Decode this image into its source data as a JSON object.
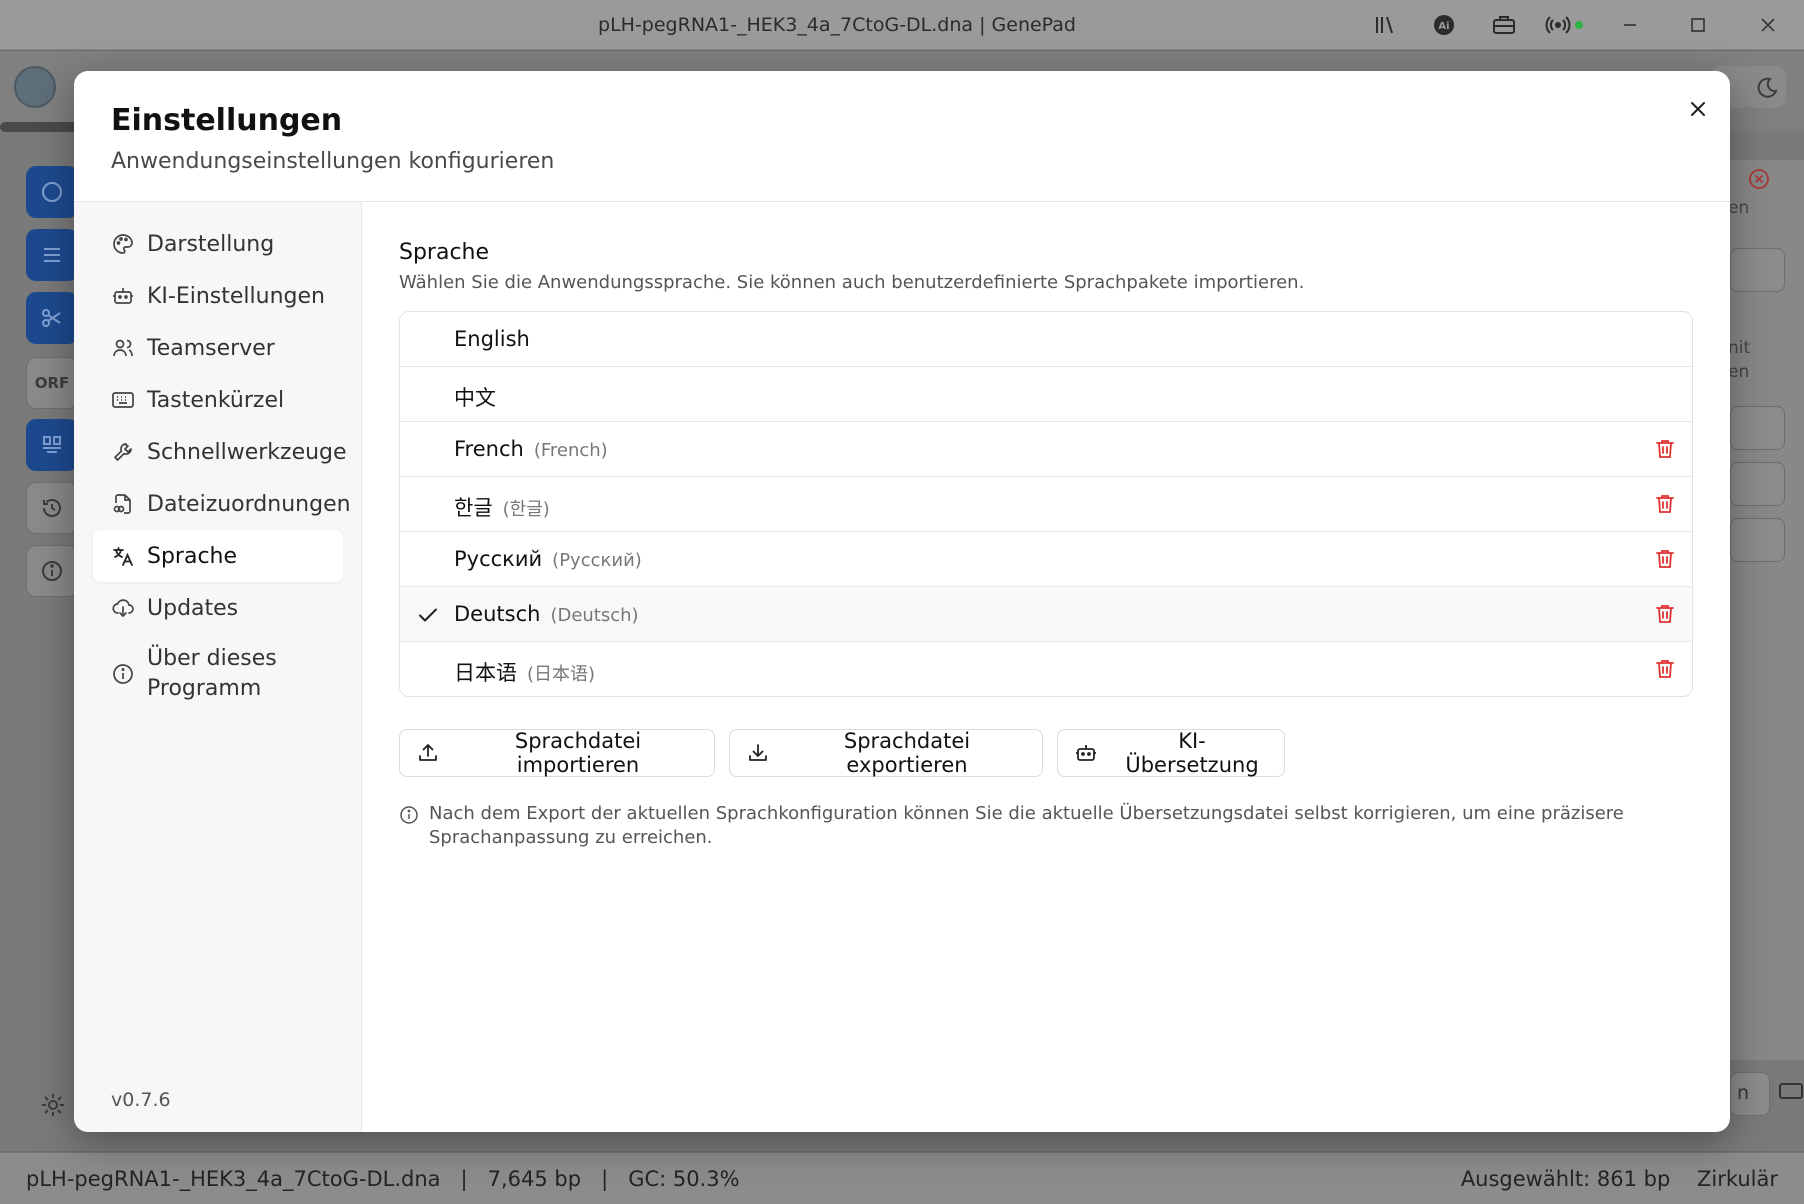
{
  "window": {
    "title": "pLH-pegRNA1-_HEK3_4a_7CtoG-DL.dna | GenePad",
    "ai_badge": "Ai"
  },
  "app": {
    "orf_label": "ORF",
    "right_panel_texts": [
      "en",
      "nit",
      "en"
    ],
    "right_panel_button": "n"
  },
  "statusbar": {
    "left": "pLH-pegRNA1-_HEK3_4a_7CtoG-DL.dna   |   7,645 bp   |   GC: 50.3%",
    "right": "Ausgewählt: 861 bp    Zirkulär"
  },
  "dialog": {
    "title": "Einstellungen",
    "subtitle": "Anwendungseinstellungen konfigurieren",
    "version": "v0.7.6",
    "nav": [
      {
        "label": "Darstellung",
        "icon": "palette-icon",
        "active": false
      },
      {
        "label": "KI-Einstellungen",
        "icon": "robot-icon",
        "active": false
      },
      {
        "label": "Teamserver",
        "icon": "users-icon",
        "active": false
      },
      {
        "label": "Tastenkürzel",
        "icon": "keyboard-icon",
        "active": false
      },
      {
        "label": "Schnellwerkzeuge",
        "icon": "wrench-icon",
        "active": false
      },
      {
        "label": "Dateizuordnungen",
        "icon": "file-link-icon",
        "active": false
      },
      {
        "label": "Sprache",
        "icon": "translate-icon",
        "active": true
      },
      {
        "label": "Updates",
        "icon": "cloud-download-icon",
        "active": false
      },
      {
        "label": "Über dieses Programm",
        "icon": "info-icon",
        "active": false
      }
    ],
    "language_section": {
      "title": "Sprache",
      "description": "Wählen Sie die Anwendungssprache. Sie können auch benutzerdefinierte Sprachpakete importieren.",
      "languages": [
        {
          "name": "English",
          "native": "",
          "selected": false,
          "deletable": false
        },
        {
          "name": "中文",
          "native": "",
          "selected": false,
          "deletable": false
        },
        {
          "name": "French",
          "native": "(French)",
          "selected": false,
          "deletable": true
        },
        {
          "name": "한글",
          "native": "(한글)",
          "selected": false,
          "deletable": true
        },
        {
          "name": "Русский",
          "native": "(Русский)",
          "selected": false,
          "deletable": true
        },
        {
          "name": "Deutsch",
          "native": "(Deutsch)",
          "selected": true,
          "deletable": true
        },
        {
          "name": "日本语",
          "native": "(日本语)",
          "selected": false,
          "deletable": true
        }
      ],
      "buttons": {
        "import": "Sprachdatei importieren",
        "export": "Sprachdatei exportieren",
        "ai_translate": "KI-Übersetzung"
      },
      "note": "Nach dem Export der aktuellen Sprachkonfiguration können Sie die aktuelle Übersetzungsdatei selbst korrigieren, um eine präzisere Sprachanpassung zu erreichen."
    }
  },
  "colors": {
    "accent_blue": "#1d4a8f",
    "delete_red": "#e03131",
    "status_green": "#2fb344"
  }
}
